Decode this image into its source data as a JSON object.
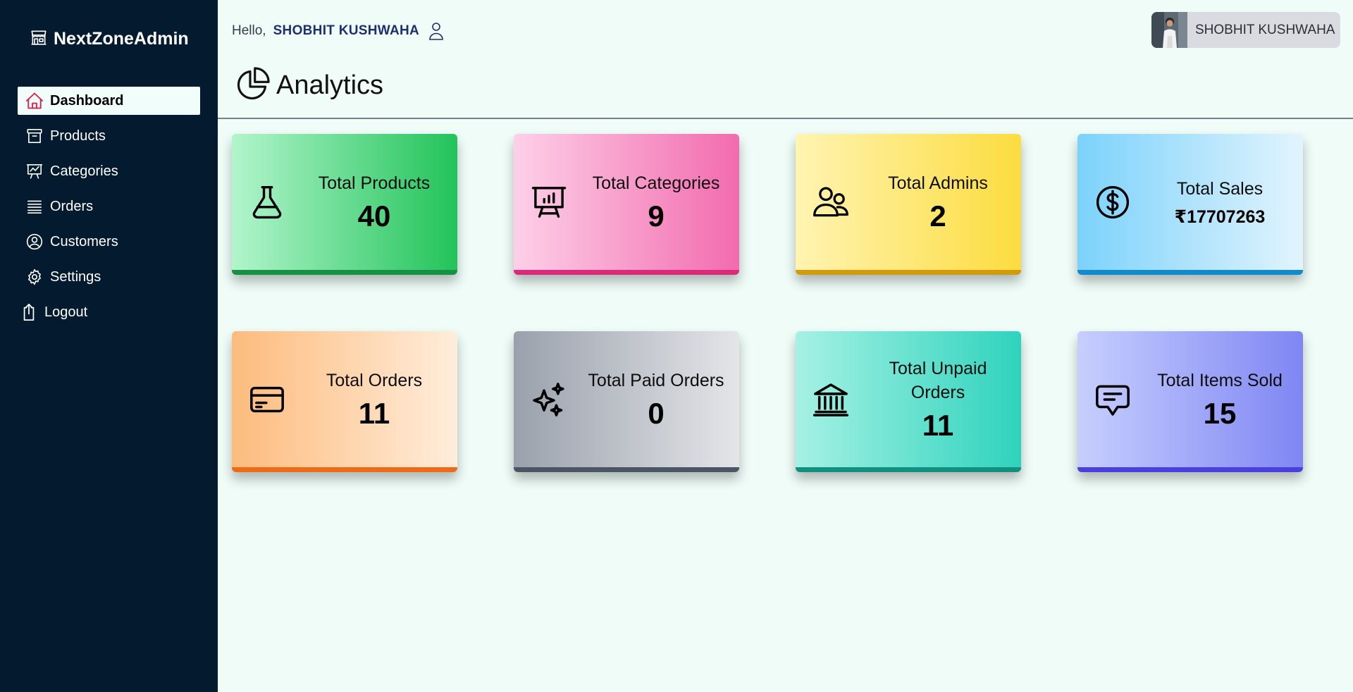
{
  "brand": {
    "name": "NextZoneAdmin",
    "icon": "store-icon"
  },
  "sidebar": {
    "items": [
      {
        "label": "Dashboard",
        "icon": "home-icon",
        "active": true
      },
      {
        "label": "Products",
        "icon": "archive-box-icon"
      },
      {
        "label": "Categories",
        "icon": "presentation-chart-icon"
      },
      {
        "label": "Orders",
        "icon": "queue-list-icon"
      },
      {
        "label": "Customers",
        "icon": "user-circle-icon"
      },
      {
        "label": "Settings",
        "icon": "gear-icon"
      },
      {
        "label": "Logout",
        "icon": "logout-icon"
      }
    ]
  },
  "header": {
    "greeting": "Hello,",
    "user_name": "SHOBHIT KUSHWAHA",
    "profile_name": "SHOBHIT KUSHWAHA"
  },
  "page": {
    "title": "Analytics",
    "icon": "pie-chart-icon"
  },
  "cards": [
    {
      "label": "Total Products",
      "value": "40",
      "icon": "beaker-icon"
    },
    {
      "label": "Total Categories",
      "value": "9",
      "icon": "presentation-chart-icon"
    },
    {
      "label": "Total Admins",
      "value": "2",
      "icon": "users-icon"
    },
    {
      "label": "Total Sales",
      "value": "₹17707263",
      "icon": "dollar-circle-icon"
    },
    {
      "label": "Total Orders",
      "value": "11",
      "icon": "credit-card-icon"
    },
    {
      "label": "Total Paid Orders",
      "value": "0",
      "icon": "sparkles-icon"
    },
    {
      "label": "Total Unpaid Orders",
      "value": "11",
      "icon": "bank-icon"
    },
    {
      "label": "Total Items Sold",
      "value": "15",
      "icon": "chat-bubble-icon"
    }
  ],
  "colors": {
    "sidebar_bg": "#031a2f",
    "page_bg": "#effcf8",
    "accent_active_icon": "#e11d48",
    "username_color": "#1e2f6e"
  }
}
